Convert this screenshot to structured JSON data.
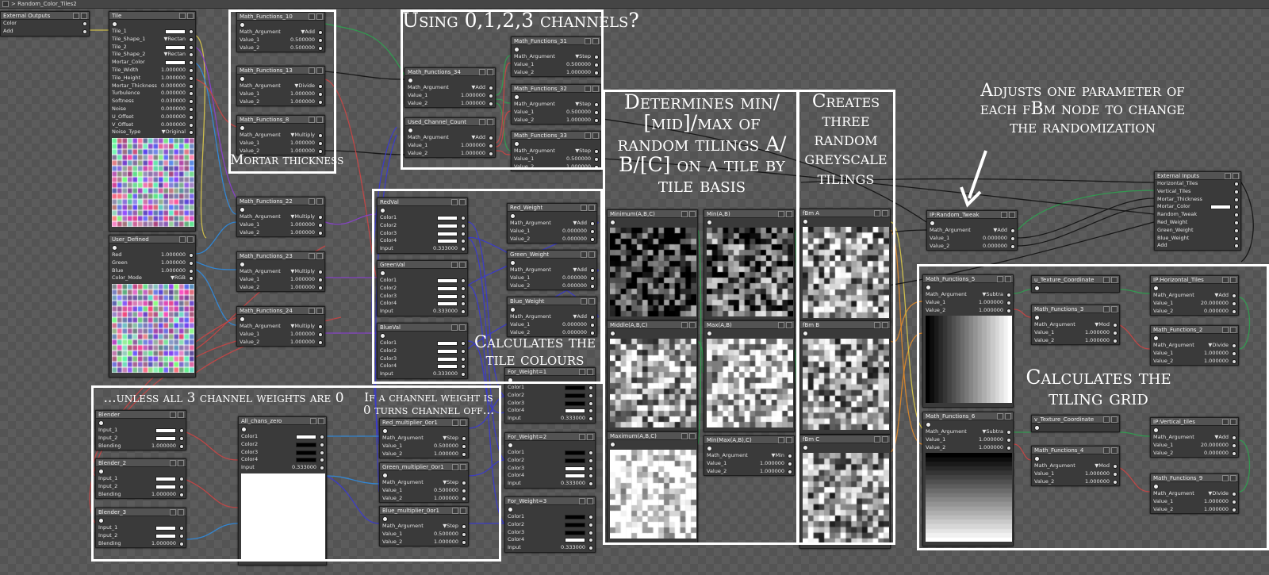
{
  "window": {
    "title": "> Random_Color_Tiles2"
  },
  "annotations": {
    "mortar": "Mortar thickness",
    "channels": "Using 0,1,2,3 channels?",
    "minmax": "Determines min/\n[mid]/max of\nrandom tilings A/\nB/[C] on a tile by\ntile basis",
    "three": "Creates\nthree\nrandom\ngreyscale\ntilings",
    "adjust": "Adjusts one parameter of\neach fBm node to change\nthe randomization",
    "tilecolors": "Calculates the\ntile colours",
    "unless": "...unless all 3 channel weights are 0",
    "ifchannel": "If a channel weight is\n0 turns channel off...",
    "grid": "Calculates the\ntiling grid"
  },
  "colors": {
    "canvas": "#5c5c5c",
    "node_body": "#3a3a3a",
    "node_header": "#535353",
    "annotation": "#ffffff"
  },
  "nodes": {
    "ext_out": {
      "title": "External Outputs",
      "rows": [
        {
          "label": "Color",
          "value": ""
        },
        {
          "label": "Add",
          "value": ""
        }
      ]
    },
    "tile": {
      "title": "Tile",
      "rows": [
        {
          "label": "Tile_1",
          "value": ""
        },
        {
          "label": "Tile_Shape_1",
          "value": "▼Rectan"
        },
        {
          "label": "Tile_2",
          "value": ""
        },
        {
          "label": "Tile_Shape_2",
          "value": "▼Rectan"
        },
        {
          "label": "Mortar_Color",
          "value": ""
        },
        {
          "label": "Tile_Width",
          "value": "1.000000"
        },
        {
          "label": "Tile_Height",
          "value": "1.000000"
        },
        {
          "label": "Mortar_Thickness",
          "value": "0.000000"
        },
        {
          "label": "Turbulence",
          "value": "0.000000"
        },
        {
          "label": "Softness",
          "value": "0.030000"
        },
        {
          "label": "Noise",
          "value": "0.000000"
        },
        {
          "label": "U_Offset",
          "value": "0.000000"
        },
        {
          "label": "V_Offset",
          "value": "0.000000"
        },
        {
          "label": "Noise_Type",
          "value": "▼Original"
        }
      ]
    },
    "user_defined": {
      "title": "User_Defined",
      "rows": [
        {
          "label": "Red",
          "value": "1.000000"
        },
        {
          "label": "Green",
          "value": "1.000000"
        },
        {
          "label": "Blue",
          "value": "1.000000"
        },
        {
          "label": "Color_Mode",
          "value": "▼RGB"
        }
      ]
    },
    "mf10": {
      "title": "Math_Functions_10",
      "rows": [
        {
          "label": "Math_Argument",
          "value": "▼Add"
        },
        {
          "label": "Value_1",
          "value": "0.500000"
        },
        {
          "label": "Value_2",
          "value": "0.500000"
        }
      ]
    },
    "mf13": {
      "title": "Math_Functions_13",
      "rows": [
        {
          "label": "Math_Argument",
          "value": "▼Divide"
        },
        {
          "label": "Value_1",
          "value": "1.000000"
        },
        {
          "label": "Value_2",
          "value": "1.000000"
        }
      ]
    },
    "mf8": {
      "title": "Math_Functions_8",
      "rows": [
        {
          "label": "Math_Argument",
          "value": "▼Multiply"
        },
        {
          "label": "Value_1",
          "value": "1.000000"
        },
        {
          "label": "Value_2",
          "value": "1.000000"
        }
      ]
    },
    "mf22": {
      "title": "Math_Functions_22",
      "rows": [
        {
          "label": "Math_Argument",
          "value": "▼Multiply"
        },
        {
          "label": "Value_1",
          "value": "1.000000"
        },
        {
          "label": "Value_2",
          "value": "1.000000"
        }
      ]
    },
    "mf23": {
      "title": "Math_Functions_23",
      "rows": [
        {
          "label": "Math_Argument",
          "value": "▼Multiply"
        },
        {
          "label": "Value_1",
          "value": "1.000000"
        },
        {
          "label": "Value_2",
          "value": "1.000000"
        }
      ]
    },
    "mf24": {
      "title": "Math_Functions_24",
      "rows": [
        {
          "label": "Math_Argument",
          "value": "▼Multiply"
        },
        {
          "label": "Value_1",
          "value": "1.000000"
        },
        {
          "label": "Value_2",
          "value": "1.000000"
        }
      ]
    },
    "mf34": {
      "title": "Math_Functions_34",
      "rows": [
        {
          "label": "Math_Argument",
          "value": "▼Add"
        },
        {
          "label": "Value_1",
          "value": "1.000000"
        },
        {
          "label": "Value_2",
          "value": "1.000000"
        }
      ]
    },
    "ucc": {
      "title": "Used_Channel_Count",
      "rows": [
        {
          "label": "Math_Argument",
          "value": "▼Add"
        },
        {
          "label": "Value_1",
          "value": "1.000000"
        },
        {
          "label": "Value_2",
          "value": "1.000000"
        }
      ]
    },
    "mf31": {
      "title": "Math_Functions_31",
      "rows": [
        {
          "label": "Math_Argument",
          "value": "▼Step"
        },
        {
          "label": "Value_1",
          "value": "0.500000"
        },
        {
          "label": "Value_2",
          "value": "1.000000"
        }
      ]
    },
    "mf32": {
      "title": "Math_Functions_32",
      "rows": [
        {
          "label": "Math_Argument",
          "value": "▼Step"
        },
        {
          "label": "Value_1",
          "value": "0.500000"
        },
        {
          "label": "Value_2",
          "value": "1.000000"
        }
      ]
    },
    "mf33": {
      "title": "Math_Functions_33",
      "rows": [
        {
          "label": "Math_Argument",
          "value": "▼Step"
        },
        {
          "label": "Value_1",
          "value": "0.500000"
        },
        {
          "label": "Value_2",
          "value": "1.000000"
        }
      ]
    },
    "redval": {
      "title": "RedVal",
      "rows": [
        {
          "label": "Color1",
          "value": ""
        },
        {
          "label": "Color2",
          "value": ""
        },
        {
          "label": "Color3",
          "value": ""
        },
        {
          "label": "Color4",
          "value": ""
        },
        {
          "label": "Input",
          "value": "0.333000"
        }
      ]
    },
    "greenval": {
      "title": "GreenVal",
      "rows": [
        {
          "label": "Color1",
          "value": ""
        },
        {
          "label": "Color2",
          "value": ""
        },
        {
          "label": "Color3",
          "value": ""
        },
        {
          "label": "Color4",
          "value": ""
        },
        {
          "label": "Input",
          "value": "0.333000"
        }
      ]
    },
    "blueval": {
      "title": "BlueVal",
      "rows": [
        {
          "label": "Color1",
          "value": ""
        },
        {
          "label": "Color2",
          "value": ""
        },
        {
          "label": "Color3",
          "value": ""
        },
        {
          "label": "Color4",
          "value": ""
        },
        {
          "label": "Input",
          "value": "0.333000"
        }
      ]
    },
    "red_w": {
      "title": "Red_Weight",
      "rows": [
        {
          "label": "Math_Argument",
          "value": "▼Add"
        },
        {
          "label": "Value_1",
          "value": "0.000000"
        },
        {
          "label": "Value_2",
          "value": "0.000000"
        }
      ]
    },
    "green_w": {
      "title": "Green_Weight",
      "rows": [
        {
          "label": "Math_Argument",
          "value": "▼Add"
        },
        {
          "label": "Value_1",
          "value": "0.000000"
        },
        {
          "label": "Value_2",
          "value": "0.000000"
        }
      ]
    },
    "blue_w": {
      "title": "Blue_Weight",
      "rows": [
        {
          "label": "Math_Argument",
          "value": "▼Add"
        },
        {
          "label": "Value_1",
          "value": "0.000000"
        },
        {
          "label": "Value_2",
          "value": "0.000000"
        }
      ]
    },
    "fw1": {
      "title": "For_Weight=1",
      "rows": [
        {
          "label": "Color1",
          "value": ""
        },
        {
          "label": "Color2",
          "value": ""
        },
        {
          "label": "Color3",
          "value": ""
        },
        {
          "label": "Color4",
          "value": ""
        },
        {
          "label": "Input",
          "value": "0.333000"
        }
      ]
    },
    "fw2": {
      "title": "For_Weight=2",
      "rows": [
        {
          "label": "Color1",
          "value": ""
        },
        {
          "label": "Color2",
          "value": ""
        },
        {
          "label": "Color3",
          "value": ""
        },
        {
          "label": "Color4",
          "value": ""
        },
        {
          "label": "Input",
          "value": "0.333000"
        }
      ]
    },
    "fw3": {
      "title": "For_Weight=3",
      "rows": [
        {
          "label": "Color1",
          "value": ""
        },
        {
          "label": "Color2",
          "value": ""
        },
        {
          "label": "Color3",
          "value": ""
        },
        {
          "label": "Color4",
          "value": ""
        },
        {
          "label": "Input",
          "value": "0.333000"
        }
      ]
    },
    "blender": {
      "title": "Blender",
      "rows": [
        {
          "label": "Input_1",
          "value": ""
        },
        {
          "label": "Input_2",
          "value": ""
        },
        {
          "label": "Blending",
          "value": "1.000000"
        }
      ]
    },
    "blender2": {
      "title": "Blender_2",
      "rows": [
        {
          "label": "Input_1",
          "value": ""
        },
        {
          "label": "Input_2",
          "value": ""
        },
        {
          "label": "Blending",
          "value": "1.000000"
        }
      ]
    },
    "blender3": {
      "title": "Blender_3",
      "rows": [
        {
          "label": "Input_1",
          "value": ""
        },
        {
          "label": "Input_2",
          "value": ""
        },
        {
          "label": "Blending",
          "value": "1.000000"
        }
      ]
    },
    "allzero": {
      "title": "All_chans_zero",
      "rows": [
        {
          "label": "Color1",
          "value": ""
        },
        {
          "label": "Color2",
          "value": ""
        },
        {
          "label": "Color3",
          "value": ""
        },
        {
          "label": "Color4",
          "value": ""
        },
        {
          "label": "Input",
          "value": "0.333000"
        }
      ]
    },
    "red_mul": {
      "title": "Red_multiplier_0or1",
      "rows": [
        {
          "label": "Math_Argument",
          "value": "▼Step"
        },
        {
          "label": "Value_1",
          "value": "0.500000"
        },
        {
          "label": "Value_2",
          "value": "1.000000"
        }
      ]
    },
    "green_mul": {
      "title": "Green_multiplier_0or1",
      "rows": [
        {
          "label": "Math_Argument",
          "value": "▼Step"
        },
        {
          "label": "Value_1",
          "value": "0.500000"
        },
        {
          "label": "Value_2",
          "value": "1.000000"
        }
      ]
    },
    "blue_mul": {
      "title": "Blue_multiplier_0or1",
      "rows": [
        {
          "label": "Math_Argument",
          "value": "▼Step"
        },
        {
          "label": "Value_1",
          "value": "0.500000"
        },
        {
          "label": "Value_2",
          "value": "1.000000"
        }
      ]
    },
    "minimum": {
      "title": "Minimum(A,B,C)",
      "rows": []
    },
    "min_ab": {
      "title": "Min(A,B)",
      "rows": []
    },
    "middle": {
      "title": "Middle(A,B,C)",
      "rows": []
    },
    "max_ab": {
      "title": "Max(A,B)",
      "rows": []
    },
    "maximum": {
      "title": "Maximum(A,B,C)",
      "rows": []
    },
    "minmax_abc": {
      "title": "Min(Max(A,B),C)",
      "rows": [
        {
          "label": "Math_Argument",
          "value": "▼Min"
        },
        {
          "label": "Value_1",
          "value": "1.000000"
        },
        {
          "label": "Value_2",
          "value": "1.000000"
        }
      ]
    },
    "fbma": {
      "title": "fBm A",
      "rows": []
    },
    "fbmb": {
      "title": "fBm B",
      "rows": []
    },
    "fbmc": {
      "title": "fBm C",
      "rows": []
    },
    "ip_rt": {
      "title": "IP:Random_Tweak",
      "rows": [
        {
          "label": "Math_Argument",
          "value": "▼Add"
        },
        {
          "label": "Value_1",
          "value": "0.000000"
        },
        {
          "label": "Value_2",
          "value": "0.000000"
        }
      ]
    },
    "ext_in": {
      "title": "External Inputs",
      "rows": [
        {
          "label": "Horizontal_Tiles",
          "value": ""
        },
        {
          "label": "Vertical_Tiles",
          "value": ""
        },
        {
          "label": "Mortar_Thickness",
          "value": ""
        },
        {
          "label": "Mortar_Color",
          "value": ""
        },
        {
          "label": "Random_Tweak",
          "value": ""
        },
        {
          "label": "Red_Weight",
          "value": ""
        },
        {
          "label": "Green_Weight",
          "value": ""
        },
        {
          "label": "Blue_Weight",
          "value": ""
        },
        {
          "label": "Add",
          "value": ""
        }
      ]
    },
    "mf5": {
      "title": "Math_Functions_5",
      "rows": [
        {
          "label": "Math_Argument",
          "value": "▼Subtra"
        },
        {
          "label": "Value_1",
          "value": "1.000000"
        },
        {
          "label": "Value_2",
          "value": "1.000000"
        }
      ]
    },
    "mf6": {
      "title": "Math_Functions_6",
      "rows": [
        {
          "label": "Math_Argument",
          "value": "▼Subtra"
        },
        {
          "label": "Value_1",
          "value": "1.000000"
        },
        {
          "label": "Value_2",
          "value": "1.000000"
        }
      ]
    },
    "utc": {
      "title": "u_Texture_Coordinate",
      "rows": []
    },
    "vtc": {
      "title": "v_Texture_Coordinate",
      "rows": []
    },
    "mf3": {
      "title": "Math_Functions_3",
      "rows": [
        {
          "label": "Math_Argument",
          "value": "▼Mod"
        },
        {
          "label": "Value_1",
          "value": "1.000000"
        },
        {
          "label": "Value_2",
          "value": "1.000000"
        }
      ]
    },
    "mf4": {
      "title": "Math_Functions_4",
      "rows": [
        {
          "label": "Math_Argument",
          "value": "▼Mod"
        },
        {
          "label": "Value_1",
          "value": "1.000000"
        },
        {
          "label": "Value_2",
          "value": "1.000000"
        }
      ]
    },
    "ip_h": {
      "title": "IP:Horizontal_Tiles",
      "rows": [
        {
          "label": "Math_Argument",
          "value": "▼Add"
        },
        {
          "label": "Value_1",
          "value": "20.000000"
        },
        {
          "label": "Value_2",
          "value": "0.000000"
        }
      ]
    },
    "mf2": {
      "title": "Math_Functions_2",
      "rows": [
        {
          "label": "Math_Argument",
          "value": "▼Divide"
        },
        {
          "label": "Value_1",
          "value": "1.000000"
        },
        {
          "label": "Value_2",
          "value": "1.000000"
        }
      ]
    },
    "ip_v": {
      "title": "IP:Vertical_tiles",
      "rows": [
        {
          "label": "Math_Argument",
          "value": "▼Add"
        },
        {
          "label": "Value_1",
          "value": "20.000000"
        },
        {
          "label": "Value_2",
          "value": "0.000000"
        }
      ]
    },
    "mf9": {
      "title": "Math_Functions_9",
      "rows": [
        {
          "label": "Math_Argument",
          "value": "▼Divide"
        },
        {
          "label": "Value_1",
          "value": "1.000000"
        },
        {
          "label": "Value_2",
          "value": "1.000000"
        }
      ]
    }
  }
}
